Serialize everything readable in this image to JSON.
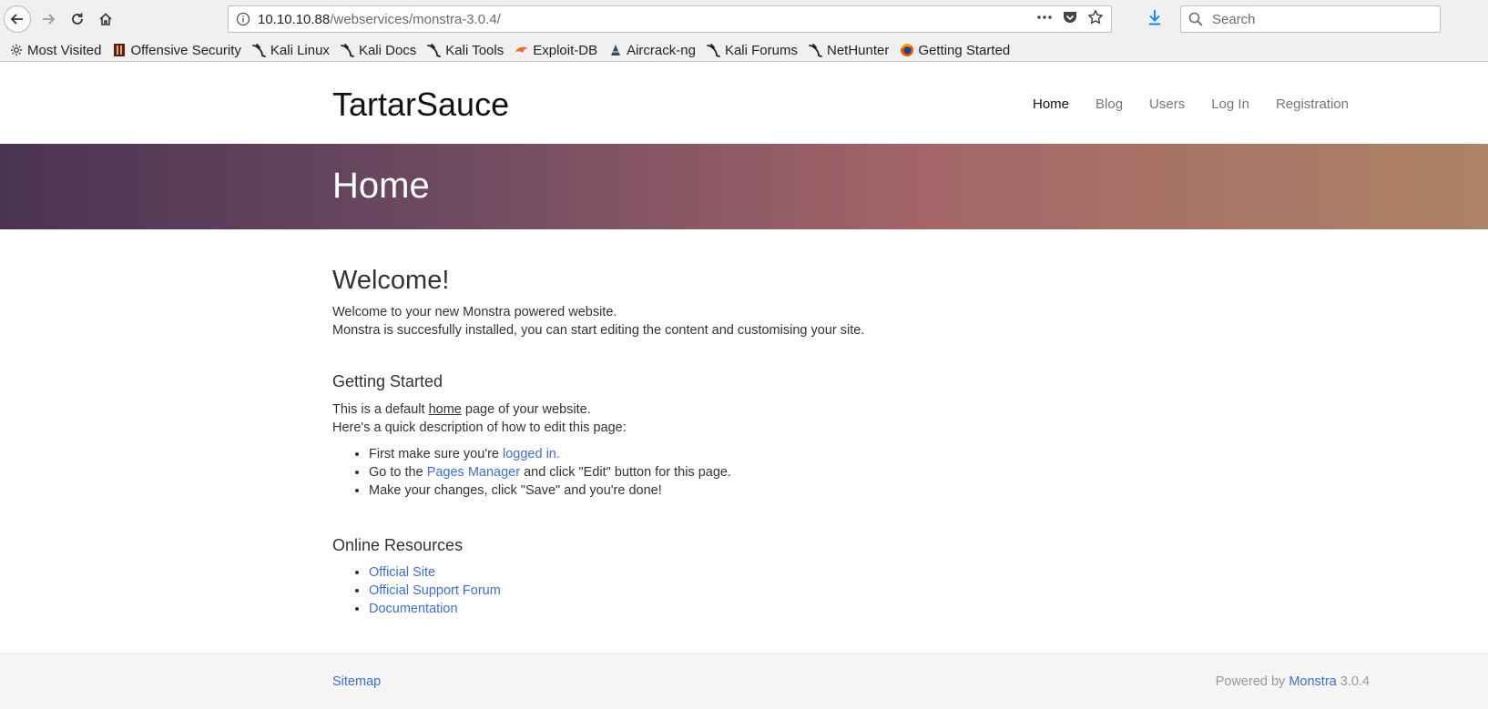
{
  "browser": {
    "url_host": "10.10.10.88",
    "url_path": "/webservices/monstra-3.0.4/",
    "search_placeholder": "Search",
    "bookmarks": [
      {
        "label": "Most Visited",
        "icon": "gear-icon"
      },
      {
        "label": "Offensive Security",
        "icon": "offsec-icon"
      },
      {
        "label": "Kali Linux",
        "icon": "kali-dragon-icon"
      },
      {
        "label": "Kali Docs",
        "icon": "kali-dragon-icon"
      },
      {
        "label": "Kali Tools",
        "icon": "kali-dragon-icon"
      },
      {
        "label": "Exploit-DB",
        "icon": "exploitdb-icon"
      },
      {
        "label": "Aircrack-ng",
        "icon": "aircrack-icon"
      },
      {
        "label": "Kali Forums",
        "icon": "kali-dragon-icon"
      },
      {
        "label": "NetHunter",
        "icon": "kali-dragon-icon"
      },
      {
        "label": "Getting Started",
        "icon": "firefox-icon"
      }
    ]
  },
  "site": {
    "brand": "TartarSauce",
    "nav": [
      "Home",
      "Blog",
      "Users",
      "Log In",
      "Registration"
    ],
    "hero_title": "Home"
  },
  "content": {
    "welcome_heading": "Welcome!",
    "welcome_line1": "Welcome to your new Monstra powered website.",
    "welcome_line2": "Monstra is succesfully installed, you can start editing the content and customising your site.",
    "getting_started_heading": "Getting Started",
    "gs_line1_pre": "This is a default ",
    "gs_line1_link": "home",
    "gs_line1_post": " page of your website.",
    "gs_line2": "Here's a quick description of how to edit this page:",
    "step1_pre": "First make sure you're ",
    "step1_link": "logged in.",
    "step2_pre": "Go to the ",
    "step2_link": "Pages Manager",
    "step2_post": " and click \"Edit\" button for this page.",
    "step3": "Make your changes, click \"Save\" and you're done!",
    "online_heading": "Online Resources",
    "resources": [
      "Official Site",
      "Official Support Forum",
      "Documentation"
    ]
  },
  "footer": {
    "sitemap": "Sitemap",
    "powered_by": "Powered by ",
    "powered_link": "Monstra",
    "version": " 3.0.4"
  },
  "colors": {
    "link": "#3d6fd6",
    "hero_start": "#4a3352",
    "hero_end": "#ad8466",
    "download_accent": "#0a84ff"
  }
}
